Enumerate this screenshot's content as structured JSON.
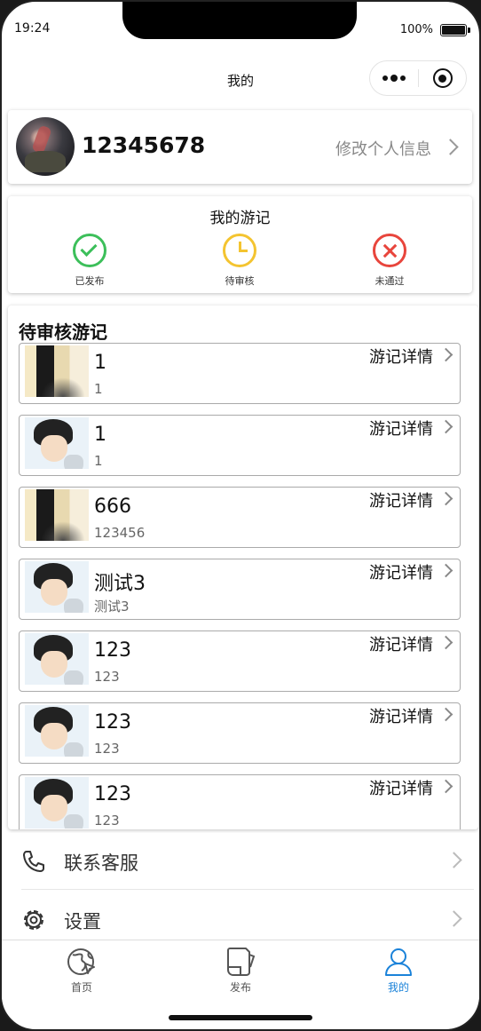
{
  "status_bar": {
    "time": "19:24",
    "battery": "100%"
  },
  "nav": {
    "title": "我的",
    "more_icon": "more-dots-icon",
    "close_icon": "target-icon"
  },
  "profile": {
    "username": "12345678",
    "edit_label": "修改个人信息"
  },
  "journal": {
    "title": "我的游记",
    "statuses": [
      {
        "label": "已发布",
        "icon": "check-circle-icon",
        "color": "#3cbf5a"
      },
      {
        "label": "待审核",
        "icon": "clock-icon",
        "color": "#f4c430"
      },
      {
        "label": "未通过",
        "icon": "cross-circle-icon",
        "color": "#e8453c"
      }
    ]
  },
  "pending": {
    "title": "待审核游记",
    "detail_label": "游记详情",
    "entries": [
      {
        "title": "1",
        "subtitle": "1",
        "thumb": "t1"
      },
      {
        "title": "1",
        "subtitle": "1",
        "thumb": "t2"
      },
      {
        "title": "666",
        "subtitle": "123456",
        "thumb": "t1"
      },
      {
        "title": "测试3",
        "subtitle": "测试3",
        "thumb": "t2"
      },
      {
        "title": "123",
        "subtitle": "123",
        "thumb": "t2"
      },
      {
        "title": "123",
        "subtitle": "123",
        "thumb": "t2"
      },
      {
        "title": "123",
        "subtitle": "123",
        "thumb": "t2"
      }
    ]
  },
  "menu": {
    "service": "联系客服",
    "settings": "设置"
  },
  "tabs": [
    {
      "label": "首页",
      "icon": "globe-icon"
    },
    {
      "label": "发布",
      "icon": "publish-icon"
    },
    {
      "label": "我的",
      "icon": "user-icon",
      "active": true
    }
  ],
  "colors": {
    "accent": "#1a82d9"
  }
}
